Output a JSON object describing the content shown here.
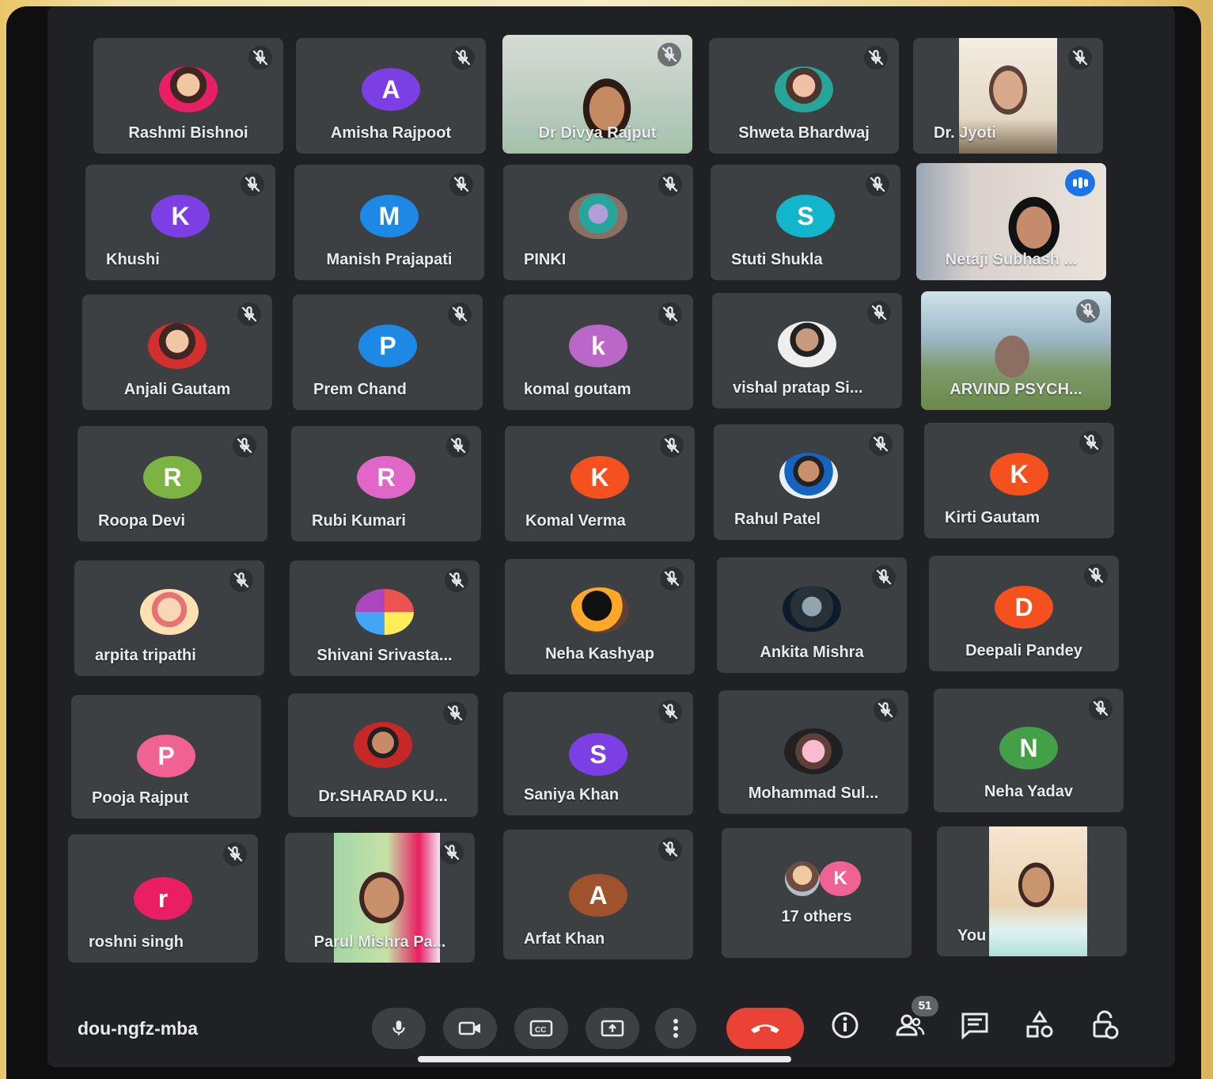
{
  "meeting": {
    "code": "dou-ngfz-mba",
    "participant_count": "51"
  },
  "tiles": [
    {
      "name": "Rashmi Bishnoi",
      "avatar_type": "photo",
      "muted": true
    },
    {
      "name": "Amisha Rajpoot",
      "initial": "A",
      "color": "#7b3fe4",
      "muted": true
    },
    {
      "name": "Dr Divya Rajput",
      "avatar_type": "video",
      "muted": true
    },
    {
      "name": "Shweta Bhardwaj",
      "avatar_type": "photo",
      "muted": true
    },
    {
      "name": "Dr. Jyoti",
      "avatar_type": "video",
      "muted": true
    },
    {
      "name": "Khushi",
      "initial": "K",
      "color": "#7b3fe4",
      "muted": true
    },
    {
      "name": "Manish Prajapati",
      "initial": "M",
      "color": "#1e88e5",
      "muted": true
    },
    {
      "name": "PINKI",
      "avatar_type": "photo",
      "muted": true
    },
    {
      "name": "Stuti Shukla",
      "initial": "S",
      "color": "#12b5cb",
      "muted": true
    },
    {
      "name": "Netaji Subhash ...",
      "avatar_type": "video",
      "speaking": true
    },
    {
      "name": "Anjali Gautam",
      "avatar_type": "photo",
      "muted": true
    },
    {
      "name": "Prem Chand",
      "initial": "P",
      "color": "#1e88e5",
      "muted": true
    },
    {
      "name": "komal goutam",
      "initial": "k",
      "color": "#ba68c8",
      "muted": true
    },
    {
      "name": "vishal pratap Si...",
      "avatar_type": "photo",
      "muted": true
    },
    {
      "name": "ARVIND PSYCH...",
      "avatar_type": "video",
      "muted": true
    },
    {
      "name": "Roopa Devi",
      "initial": "R",
      "color": "#7cb342",
      "muted": true
    },
    {
      "name": "Rubi Kumari",
      "initial": "R",
      "color": "#e066c8",
      "muted": true
    },
    {
      "name": "Komal Verma",
      "initial": "K",
      "color": "#f4511e",
      "muted": true
    },
    {
      "name": "Rahul Patel",
      "avatar_type": "photo",
      "muted": true
    },
    {
      "name": "Kirti Gautam",
      "initial": "K",
      "color": "#f4511e",
      "muted": true
    },
    {
      "name": "arpita tripathi",
      "avatar_type": "photo",
      "muted": true
    },
    {
      "name": "Shivani Srivasta...",
      "avatar_type": "photo",
      "muted": true
    },
    {
      "name": "Neha Kashyap",
      "avatar_type": "photo",
      "muted": true
    },
    {
      "name": "Ankita Mishra",
      "avatar_type": "photo",
      "muted": true
    },
    {
      "name": "Deepali Pandey",
      "initial": "D",
      "color": "#f4511e",
      "muted": true
    },
    {
      "name": "Pooja Rajput",
      "initial": "P",
      "color": "#f06292",
      "muted": false
    },
    {
      "name": "Dr.SHARAD KU...",
      "avatar_type": "photo",
      "muted": true
    },
    {
      "name": "Saniya Khan",
      "initial": "S",
      "color": "#7b3fe4",
      "muted": true
    },
    {
      "name": "Mohammad Sul...",
      "avatar_type": "photo",
      "muted": true
    },
    {
      "name": "Neha Yadav",
      "initial": "N",
      "color": "#43a047",
      "muted": true
    },
    {
      "name": "roshni singh",
      "initial": "r",
      "color": "#e91e63",
      "muted": true
    },
    {
      "name": "Parul Mishra Pa...",
      "avatar_type": "video",
      "muted": true
    },
    {
      "name": "Arfat Khan",
      "initial": "A",
      "color": "#a0522d",
      "muted": true
    },
    {
      "name": "17 others",
      "avatar_type": "others",
      "others_initial": "K",
      "muted": false
    },
    {
      "name": "You",
      "avatar_type": "video",
      "muted": false
    }
  ],
  "icons": {
    "mic": "mic-icon",
    "camera": "camera-icon",
    "captions": "captions-icon",
    "present": "present-icon",
    "more": "more-options-icon",
    "end": "end-call-icon",
    "info": "info-icon",
    "people": "people-icon",
    "chat": "chat-icon",
    "activities": "activities-icon",
    "host": "host-controls-icon"
  },
  "colors": {
    "tile": "#3c4043",
    "background": "#202124",
    "end_call": "#ea4335",
    "speaking": "#8ab4f8"
  }
}
